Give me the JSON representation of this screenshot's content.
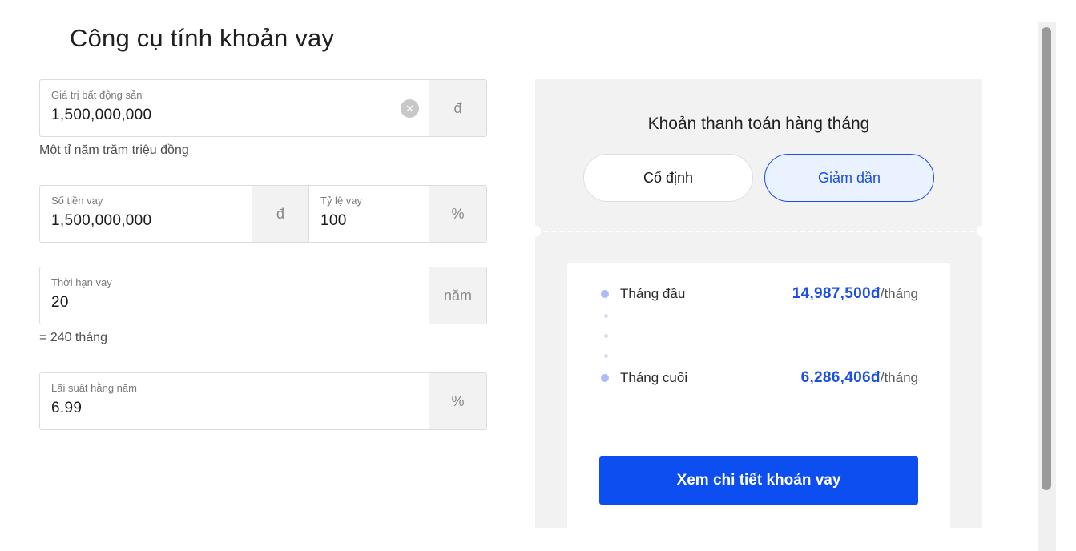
{
  "page_title": "Công cụ tính khoản vay",
  "property_value": {
    "label": "Giá trị bất động sản",
    "value": "1,500,000,000",
    "unit": "đ",
    "clear_icon": "close-icon",
    "in_words": "Một tỉ năm trăm triệu đồng"
  },
  "loan_amount": {
    "label": "Số tiền vay",
    "value": "1,500,000,000",
    "unit": "đ"
  },
  "loan_ratio": {
    "label": "Tỷ lệ vay",
    "value": "100",
    "unit": "%"
  },
  "loan_term": {
    "label": "Thời hạn vay",
    "value": "20",
    "unit": "năm",
    "hint": "= 240 tháng"
  },
  "interest_rate": {
    "label": "Lãi suất hằng năm",
    "value": "6.99",
    "unit": "%"
  },
  "result": {
    "title": "Khoản thanh toán hàng tháng",
    "toggle_fixed": "Cố định",
    "toggle_decreasing": "Giảm dần",
    "selected": "Giảm dần",
    "first_month_label": "Tháng đầu",
    "first_month_amount": "14,987,500đ",
    "last_month_label": "Tháng cuối",
    "last_month_amount": "6,286,406đ",
    "per_month": "/tháng",
    "cta_label": "Xem chi tiết khoản vay"
  },
  "colors": {
    "accent": "#0c4ef0",
    "panel_bg": "#f2f2f2"
  }
}
